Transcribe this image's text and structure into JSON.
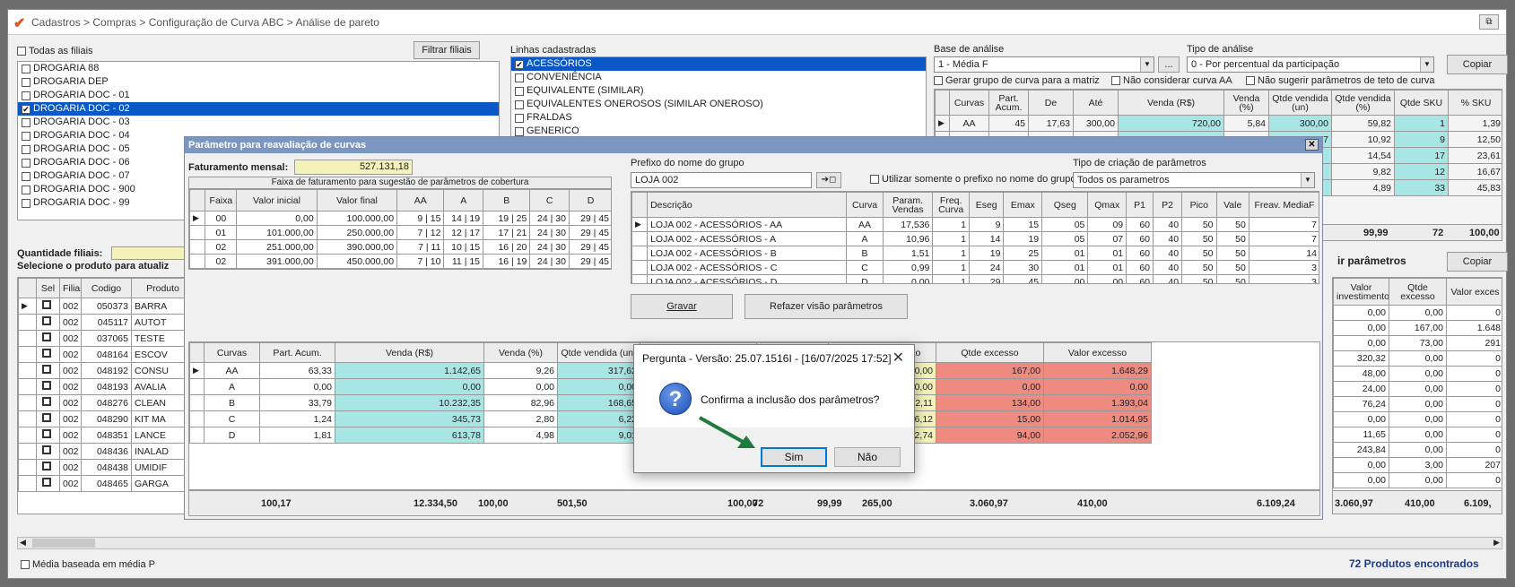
{
  "window": {
    "breadcrumb": "Cadastros > Compras > Configuração de Curva ABC > Análise de pareto"
  },
  "filiais": {
    "todas_label": "Todas as filiais",
    "filtrar_btn": "Filtrar filiais",
    "items": [
      {
        "label": "DROGARIA 88",
        "checked": false,
        "selected": false
      },
      {
        "label": "DROGARIA DEP",
        "checked": false,
        "selected": false
      },
      {
        "label": "DROGARIA DOC - 01",
        "checked": false,
        "selected": false
      },
      {
        "label": "DROGARIA DOC - 02",
        "checked": true,
        "selected": true
      },
      {
        "label": "DROGARIA DOC - 03",
        "checked": false,
        "selected": false
      },
      {
        "label": "DROGARIA DOC - 04",
        "checked": false,
        "selected": false
      },
      {
        "label": "DROGARIA DOC - 05",
        "checked": false,
        "selected": false
      },
      {
        "label": "DROGARIA DOC - 06",
        "checked": false,
        "selected": false
      },
      {
        "label": "DROGARIA DOC - 07",
        "checked": false,
        "selected": false
      },
      {
        "label": "DROGARIA DOC - 900",
        "checked": false,
        "selected": false
      },
      {
        "label": "DROGARIA DOC - 99",
        "checked": false,
        "selected": false
      }
    ],
    "quantidade_label": "Quantidade filiais:",
    "selecione_label": "Selecione o produto para atualiz"
  },
  "linhas": {
    "label": "Linhas cadastradas",
    "items": [
      {
        "label": "ACESSÓRIOS",
        "checked": true,
        "selected": true
      },
      {
        "label": "CONVENIÊNCIA",
        "checked": false,
        "selected": false
      },
      {
        "label": "EQUIVALENTE (SIMILAR)",
        "checked": false,
        "selected": false
      },
      {
        "label": "EQUIVALENTES ONEROSOS (SIMILAR ONEROSO)",
        "checked": false,
        "selected": false
      },
      {
        "label": "FRALDAS",
        "checked": false,
        "selected": false
      },
      {
        "label": "GENERICO",
        "checked": false,
        "selected": false
      },
      {
        "label": "GENERICOS ONEROSOS",
        "checked": false,
        "selected": false
      }
    ]
  },
  "base": {
    "label": "Base de análise",
    "value": "1 - Média F",
    "tipo_label": "Tipo de análise",
    "tipo_value": "0 - Por percentual da participação",
    "copiar": "Copiar",
    "dots": "...",
    "opt1": "Gerar grupo de curva para a matriz",
    "opt2": "Não considerar curva AA",
    "opt3": "Não sugerir parâmetros de teto de curva"
  },
  "top_grid": {
    "headers": [
      "Curvas",
      "Part. Acum.",
      "De",
      "Até",
      "Venda (R$)",
      "Venda (%)",
      "Qtde vendida (un)",
      "Qtde vendida (%)",
      "Qtde SKU",
      "% SKU"
    ],
    "rows": [
      [
        "AA",
        "45",
        "17,63",
        "300,00",
        "720,00",
        "5,84",
        "300,00",
        "59,82",
        "1",
        "1,39"
      ],
      [
        "A",
        "70",
        "4,30",
        "17,62",
        "2.536,24",
        "20,56",
        "54,77",
        "10,92",
        "9",
        "12,50"
      ],
      [
        "",
        "",
        "",
        "",
        "",
        "",
        "",
        "14,54",
        "17",
        "23,61"
      ],
      [
        "",
        "",
        "",
        "",
        "",
        "",
        "",
        "9,82",
        "12",
        "16,67"
      ],
      [
        "",
        "",
        "",
        "",
        "",
        "",
        "",
        "4,89",
        "33",
        "45,83"
      ]
    ],
    "totals": [
      "99,99",
      "72",
      "100,00"
    ]
  },
  "right_side": {
    "btn_params": "ir parâmetros",
    "copiar": "Copiar",
    "headers": [
      "Valor investimento",
      "Qtde excesso",
      "Valor exces"
    ],
    "rows": [
      [
        "0,00",
        "0,00",
        "0"
      ],
      [
        "0,00",
        "167,00",
        "1.648"
      ],
      [
        "0,00",
        "73,00",
        "291"
      ],
      [
        "320,32",
        "0,00",
        "0"
      ],
      [
        "48,00",
        "0,00",
        "0"
      ],
      [
        "24,00",
        "0,00",
        "0"
      ],
      [
        "76,24",
        "0,00",
        "0"
      ],
      [
        "0,00",
        "0,00",
        "0"
      ],
      [
        "11,65",
        "0,00",
        "0"
      ],
      [
        "243,84",
        "0,00",
        "0"
      ],
      [
        "0,00",
        "3,00",
        "207"
      ],
      [
        "0,00",
        "0,00",
        "0"
      ]
    ],
    "totals": [
      "3.060,97",
      "410,00",
      "6.109,"
    ]
  },
  "products": {
    "headers": [
      "Sel",
      "Filial",
      "Codigo",
      "Produto"
    ],
    "rows": [
      [
        "002",
        "050373",
        "BARRA"
      ],
      [
        "002",
        "045117",
        "AUTOT"
      ],
      [
        "002",
        "037065",
        "TESTE"
      ],
      [
        "002",
        "048164",
        "ESCOV"
      ],
      [
        "002",
        "048192",
        "CONSU"
      ],
      [
        "002",
        "048193",
        "AVALIA"
      ],
      [
        "002",
        "048276",
        "CLEAN"
      ],
      [
        "002",
        "048290",
        "KIT MA"
      ],
      [
        "002",
        "048351",
        "LANCE"
      ],
      [
        "002",
        "048436",
        "INALAD"
      ],
      [
        "002",
        "048438",
        "UMIDIF"
      ],
      [
        "002",
        "048465",
        "GARGA"
      ]
    ]
  },
  "footer": {
    "media_label": "Média baseada em média P",
    "found": "72 Produtos encontrados"
  },
  "param_panel": {
    "title": "Parâmetro para reavaliação de curvas",
    "fat_label": "Faturamento mensal:",
    "fat_value": "527.131,18",
    "faixa_caption": "Faixa de faturamento para sugestão de parâmetros de cobertura",
    "faixa_headers": [
      "Faixa",
      "Valor inicial",
      "Valor final",
      "AA",
      "A",
      "B",
      "C",
      "D"
    ],
    "faixa_rows": [
      [
        "00",
        "0,00",
        "100.000,00",
        "9 | 15",
        "14 | 19",
        "19 | 25",
        "24 | 30",
        "29 | 45"
      ],
      [
        "01",
        "101.000,00",
        "250.000,00",
        "7 | 12",
        "12 | 17",
        "17 | 21",
        "24 | 30",
        "29 | 45"
      ],
      [
        "02",
        "251.000,00",
        "390.000,00",
        "7 | 11",
        "10 | 15",
        "16 | 20",
        "24 | 30",
        "29 | 45"
      ],
      [
        "02",
        "391.000,00",
        "450.000,00",
        "7 | 10",
        "11 | 15",
        "16 | 19",
        "24 | 30",
        "29 | 45"
      ]
    ],
    "prefix_label": "Prefixo do nome do grupo",
    "prefix_value": "LOJA 002",
    "prefix_btn": "➔◻",
    "usar_label": "Utilizar somente o prefixo no nome do grupo",
    "tipo_label": "Tipo de criação de parâmetros",
    "tipo_value": "Todos os parametros",
    "desc_headers": [
      "Descrição",
      "Curva",
      "Param. Vendas",
      "Freq. Curva",
      "Eseg",
      "Emax",
      "Qseg",
      "Qmax",
      "P1",
      "P2",
      "Pico",
      "Vale",
      "Freav. MediaF"
    ],
    "desc_rows": [
      [
        "LOJA 002 - ACESSÓRIOS - AA",
        "AA",
        "17,536",
        "1",
        "9",
        "15",
        "05",
        "09",
        "60",
        "40",
        "50",
        "50",
        "7"
      ],
      [
        "LOJA 002 - ACESSÓRIOS - A",
        "A",
        "10,96",
        "1",
        "14",
        "19",
        "05",
        "07",
        "60",
        "40",
        "50",
        "50",
        "7"
      ],
      [
        "LOJA 002 - ACESSÓRIOS - B",
        "B",
        "1,51",
        "1",
        "19",
        "25",
        "01",
        "01",
        "60",
        "40",
        "50",
        "50",
        "14"
      ],
      [
        "LOJA 002 - ACESSÓRIOS - C",
        "C",
        "0,99",
        "1",
        "24",
        "30",
        "01",
        "01",
        "60",
        "40",
        "50",
        "50",
        "3"
      ],
      [
        "LOJA 002 - ACESSÓRIOS - D",
        "D",
        "0,00",
        "1",
        "29",
        "45",
        "00",
        "00",
        "60",
        "40",
        "50",
        "50",
        "3"
      ]
    ],
    "gravar": "Gravar",
    "refazer": "Refazer visão parâmetros",
    "bottom_headers": [
      "Curvas",
      "Part. Acum.",
      "Venda (R$)",
      "Venda (%)",
      "Qtde vendida (un)",
      "Qtde",
      "ssidade",
      "Valor investimento",
      "Qtde excesso",
      "Valor excesso"
    ],
    "bottom_rows": [
      [
        "AA",
        "63,33",
        "1.142,65",
        "9,26",
        "317,62",
        "",
        "150,00",
        "0,00",
        "167,00",
        "1.648,29"
      ],
      [
        "A",
        "0,00",
        "0,00",
        "0,00",
        "0,00",
        "",
        "0,00",
        "0,00",
        "0,00",
        "0,00"
      ],
      [
        "B",
        "33,79",
        "10.232,35",
        "82,96",
        "168,65",
        "",
        "110,00",
        "2.952,11",
        "134,00",
        "1.393,04"
      ],
      [
        "C",
        "1,24",
        "345,73",
        "2,80",
        "6,22",
        "",
        "3,00",
        "56,12",
        "15,00",
        "1.014,95"
      ],
      [
        "D",
        "1,81",
        "613,78",
        "4,98",
        "9,01",
        "",
        "2,00",
        "52,74",
        "94,00",
        "2.052,96"
      ]
    ],
    "bottom_totals": [
      "100,17",
      "12.334,50",
      "100,00",
      "501,50",
      "100,00",
      "72",
      "99,99",
      "265,00",
      "3.060,97",
      "410,00",
      "6.109,24"
    ]
  },
  "dialog": {
    "title": "Pergunta - Versão: 25.07.1516I - [16/07/2025 17:52]",
    "message": "Confirma a inclusão dos parâmetros?",
    "yes": "Sim",
    "no": "Não",
    "close": "✕",
    "q": "?"
  },
  "colors": {
    "accent_arrow": "#1e7a3e",
    "selection": "#0a58c8"
  }
}
